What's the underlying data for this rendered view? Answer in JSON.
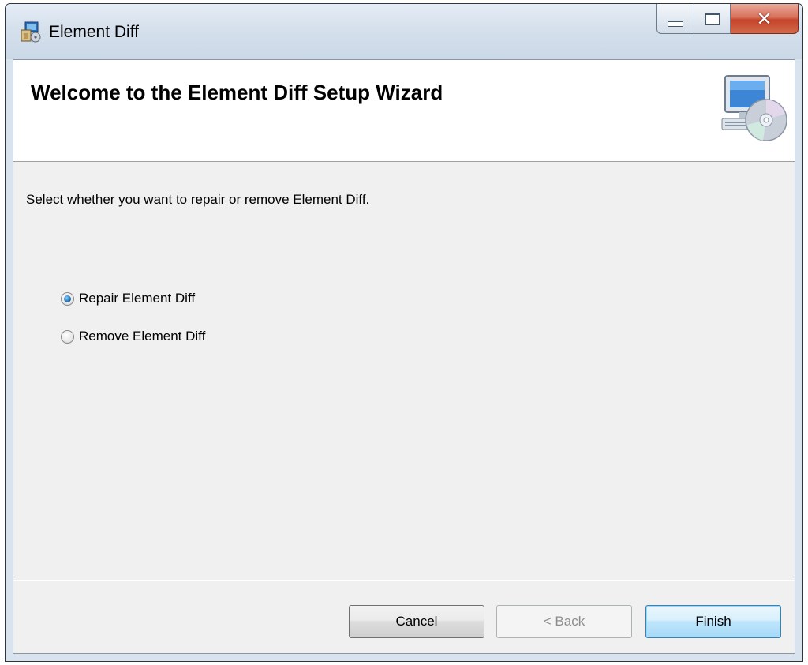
{
  "window": {
    "title": "Element Diff"
  },
  "banner": {
    "title": "Welcome to the Element Diff Setup Wizard",
    "icon": "computer-with-cd-icon"
  },
  "body": {
    "instruction": "Select whether you want to repair or remove Element Diff.",
    "options": [
      {
        "label": "Repair Element Diff",
        "selected": true
      },
      {
        "label": "Remove Element Diff",
        "selected": false
      }
    ]
  },
  "buttons": {
    "cancel": "Cancel",
    "back": "< Back",
    "finish": "Finish"
  },
  "icons": {
    "app": "installer-package-icon",
    "minimize": "minimize-icon",
    "maximize": "maximize-icon",
    "close": "close-icon"
  },
  "colors": {
    "titlebar": "#d5e0ec",
    "close_button": "#c4442a",
    "dialog_background": "#f0f0f0",
    "banner_background": "#ffffff",
    "default_button_border": "#3c7fb1"
  }
}
